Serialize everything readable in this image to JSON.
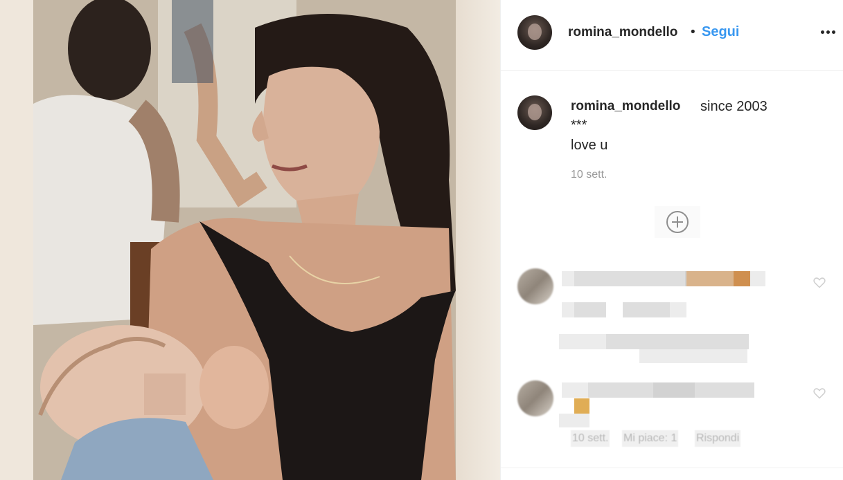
{
  "header": {
    "username": "romina_mondello",
    "separator": "•",
    "follow_label": "Segui"
  },
  "caption": {
    "username": "romina_mondello",
    "text": "since 2003",
    "line2": "***",
    "line3": "love u",
    "time": "10 sett."
  },
  "comments_meta": {
    "time": "10 sett.",
    "likes": "Mi piace: 1",
    "reply": "Rispondi"
  },
  "icons": {
    "more": "more-options-icon",
    "load_more": "plus-circle-icon",
    "like": "heart-icon"
  },
  "colors": {
    "link": "#3897f0",
    "text": "#262626",
    "muted": "#999999"
  }
}
